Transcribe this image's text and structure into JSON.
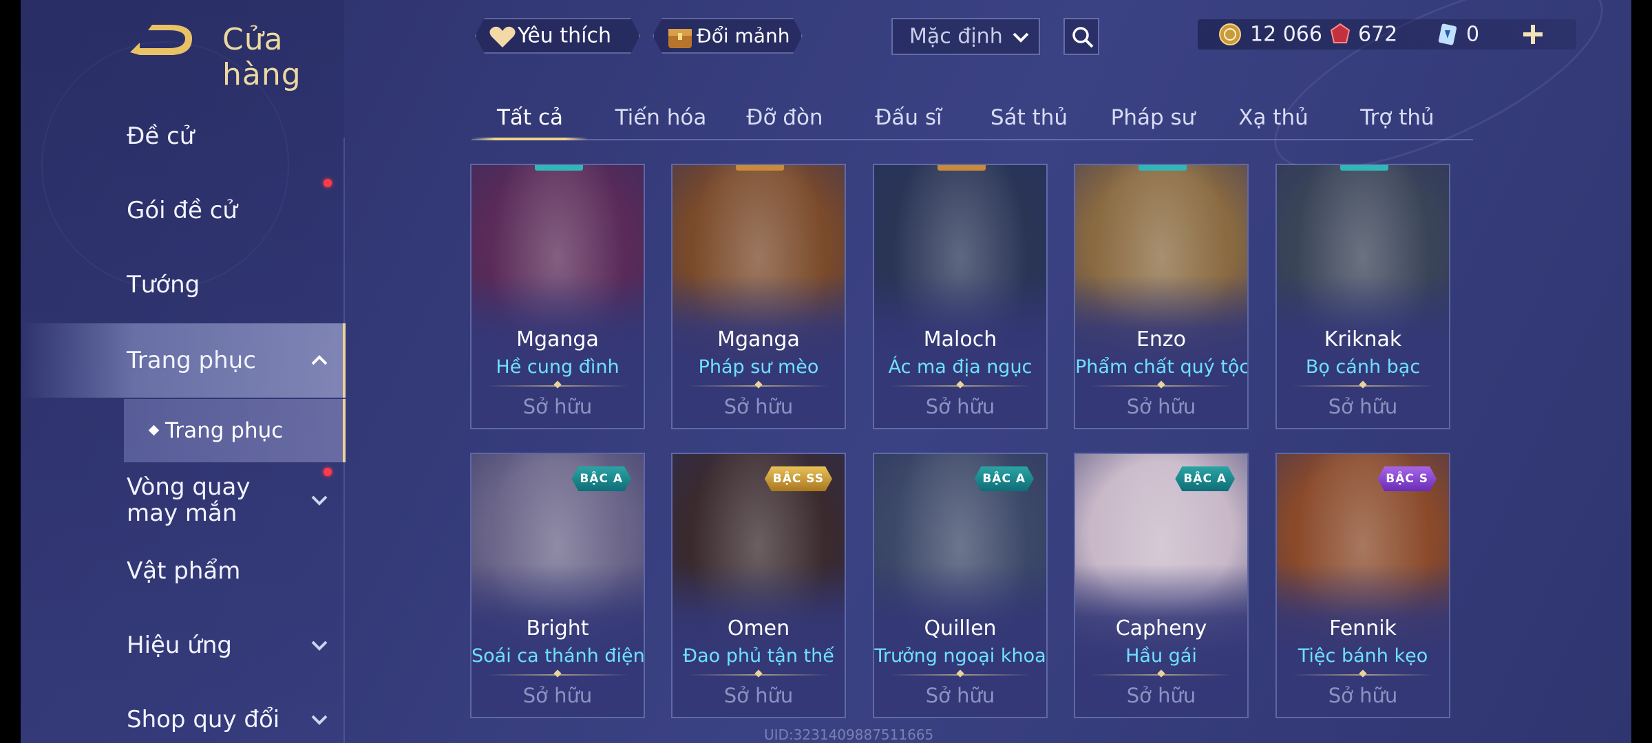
{
  "header": {
    "title": "Cửa hàng",
    "favorites_label": "Yêu thích",
    "exchange_label": "Đổi mảnh",
    "sort_selected": "Mặc định"
  },
  "currency": {
    "gold": "12 066",
    "ruby": "672",
    "voucher": "0"
  },
  "sidebar": {
    "items": [
      {
        "label": "Đề cử"
      },
      {
        "label": "Gói đề cử"
      },
      {
        "label": "Tướng"
      },
      {
        "label": "Trang phục"
      },
      {
        "label": "Vòng quay may mắn"
      },
      {
        "label": "Vật phẩm"
      },
      {
        "label": "Hiệu ứng"
      },
      {
        "label": "Shop quy đổi"
      }
    ],
    "sub_item": "Trang phục"
  },
  "tabs": [
    "Tất cả",
    "Tiến hóa",
    "Đỡ đòn",
    "Đấu sĩ",
    "Sát thủ",
    "Pháp sư",
    "Xạ thủ",
    "Trợ thủ"
  ],
  "cards": [
    {
      "hero": "Mganga",
      "skin": "Hề cung đình",
      "status": "Sở hữu",
      "badge": "",
      "color": "#5a2a58"
    },
    {
      "hero": "Mganga",
      "skin": "Pháp sư mèo",
      "status": "Sở hữu",
      "badge": "",
      "color": "#7a4a2a"
    },
    {
      "hero": "Maloch",
      "skin": "Ác ma địa ngục",
      "status": "Sở hữu",
      "badge": "",
      "color": "#2a3556"
    },
    {
      "hero": "Enzo",
      "skin": "Phẩm chất quý tộc",
      "status": "Sở hữu",
      "badge": "",
      "color": "#8a6a40"
    },
    {
      "hero": "Kriknak",
      "skin": "Bọ cánh bạc",
      "status": "Sở hữu",
      "badge": "",
      "color": "#3a4458"
    },
    {
      "hero": "Bright",
      "skin": "Soái ca thánh điện",
      "status": "Sở hữu",
      "badge": "BẬC A",
      "color": "#6a6488"
    },
    {
      "hero": "Omen",
      "skin": "Đao phủ tận thế",
      "status": "Sở hữu",
      "badge": "BẬC SS",
      "color": "#3a2a2e"
    },
    {
      "hero": "Quillen",
      "skin": "Trưởng ngoại khoa",
      "status": "Sở hữu",
      "badge": "BẬC A",
      "color": "#3c4868"
    },
    {
      "hero": "Capheny",
      "skin": "Hầu gái",
      "status": "Sở hữu",
      "badge": "BẬC A",
      "color": "#c8b8c8"
    },
    {
      "hero": "Fennik",
      "skin": "Tiệc bánh kẹo",
      "status": "Sở hữu",
      "badge": "BẬC S",
      "color": "#8a4a2a"
    }
  ],
  "footer": {
    "uid": "UID:3231409887511665"
  }
}
